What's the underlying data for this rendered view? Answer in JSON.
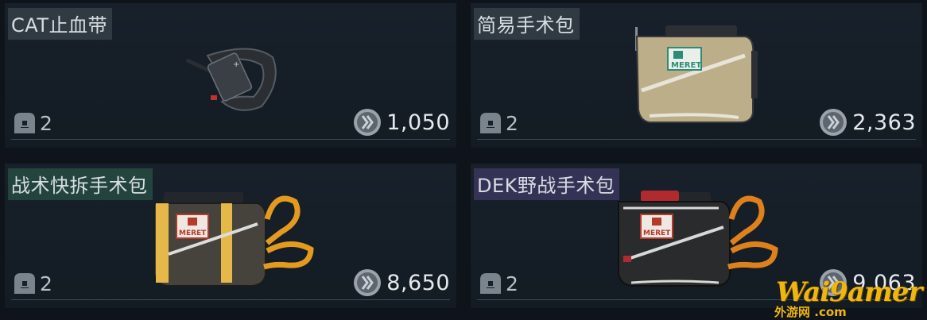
{
  "items": [
    {
      "name": "CAT止血带",
      "slots": "2",
      "price": "1,050"
    },
    {
      "name": "简易手术包",
      "slots": "2",
      "price": "2,363"
    },
    {
      "name": "战术快拆手术包",
      "slots": "2",
      "price": "8,650"
    },
    {
      "name": "DEK野战手术包",
      "slots": "2",
      "price": "9,063"
    }
  ],
  "brand_text": "MERET",
  "watermark": {
    "text": "Wai9amer",
    "sub": "外游网",
    "domain": ".com"
  },
  "colors": {
    "background": "#0e1419",
    "title_default_bg": "#465058",
    "title_green_bg": "#285046",
    "title_purple_bg": "#3c3860",
    "watermark": "#f0b60f"
  },
  "icons": {
    "slot": "backpack-slot-icon",
    "currency": "silver-coin-icon"
  }
}
